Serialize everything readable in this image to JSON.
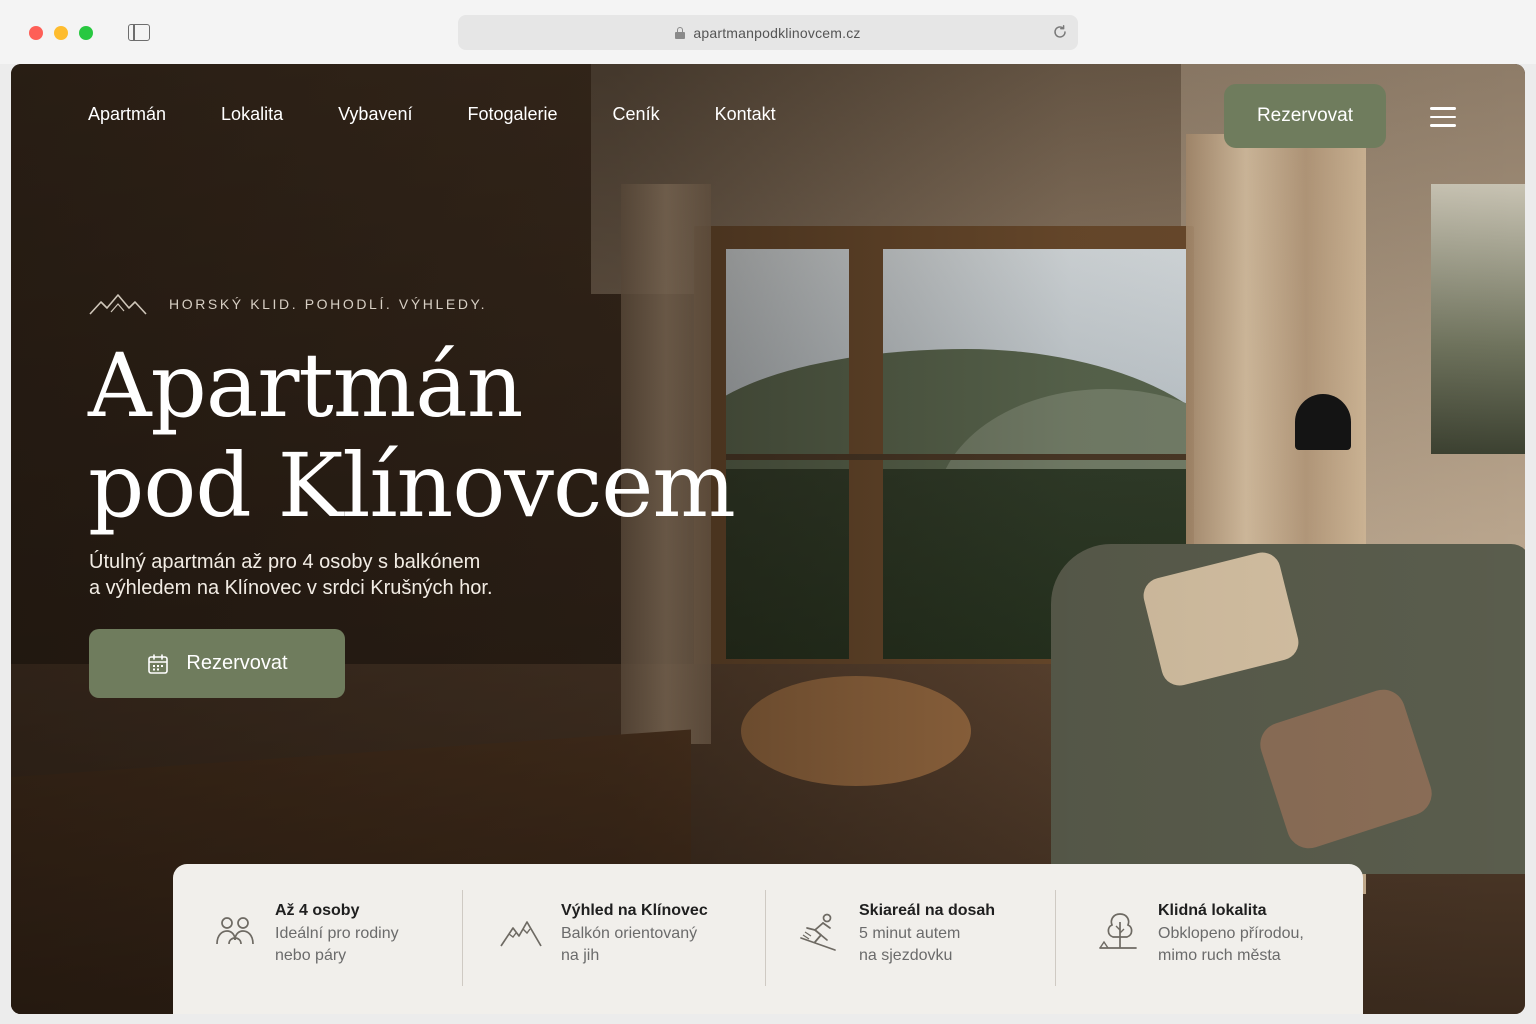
{
  "browser": {
    "url": "apartmanpodklinovcem.cz"
  },
  "nav": {
    "items": [
      "Apartmán",
      "Lokalita",
      "Vybavení",
      "Fotogalerie",
      "Ceník",
      "Kontakt"
    ],
    "cta_label": "Rezervovat"
  },
  "hero": {
    "tagline": "HORSKÝ KLID. POHODLÍ. VÝHLEDY.",
    "title_line1": "Apartmán",
    "title_line2": "pod Klínovcem",
    "subtitle_line1": "Útulný apartmán až pro 4 osoby s balkónem",
    "subtitle_line2": "a výhledem na Klínovec v srdci Krušných hor.",
    "cta_label": "Rezervovat"
  },
  "features": [
    {
      "icon": "people-icon",
      "title": "Až 4 osoby",
      "desc_line1": "Ideální pro rodiny",
      "desc_line2": "nebo páry"
    },
    {
      "icon": "mountain-icon",
      "title": "Výhled na Klínovec",
      "desc_line1": "Balkón orientovaný",
      "desc_line2": "na jih"
    },
    {
      "icon": "skier-icon",
      "title": "Skiareál na dosah",
      "desc_line1": "5 minut autem",
      "desc_line2": "na sjezdovku"
    },
    {
      "icon": "tree-icon",
      "title": "Klidná lokalita",
      "desc_line1": "Obklopeno přírodou,",
      "desc_line2": "mimo ruch města"
    }
  ],
  "colors": {
    "accent_green": "#6f7c5d",
    "feature_bar_bg": "#f1efeb"
  }
}
